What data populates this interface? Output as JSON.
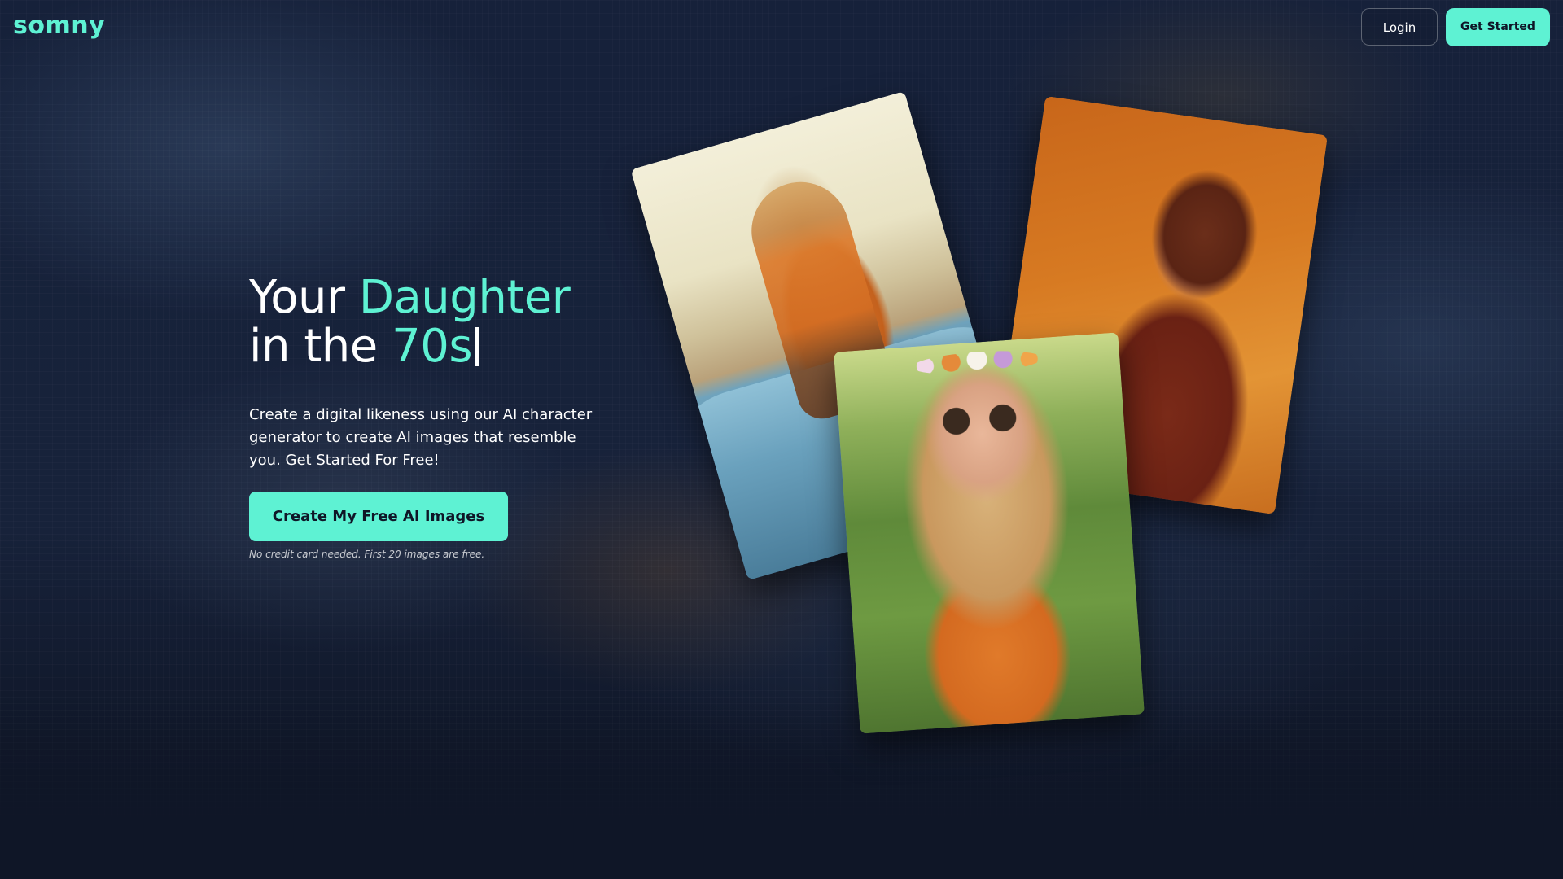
{
  "header": {
    "logo_text": "somny",
    "login_label": "Login",
    "get_started_label": "Get Started"
  },
  "hero": {
    "title_line1_prefix": "Your",
    "title_line1_accent": "Daughter",
    "title_line2_prefix": "in the",
    "title_line2_accent": "70s",
    "description": "Create a digital likeness using our AI character generator to create AI images that resemble you. Get Started For Free!",
    "cta_label": "Create My Free AI Images",
    "cta_note": "No credit card needed. First 20 images are free."
  },
  "gallery": {
    "photos": [
      {
        "name": "photo-girl-on-blue-car"
      },
      {
        "name": "photo-portrait-orange-backdrop"
      },
      {
        "name": "photo-girl-flower-crown-field"
      }
    ]
  },
  "colors": {
    "accent": "#5ef2d3",
    "background": "#0f1627",
    "text": "#ffffff"
  }
}
